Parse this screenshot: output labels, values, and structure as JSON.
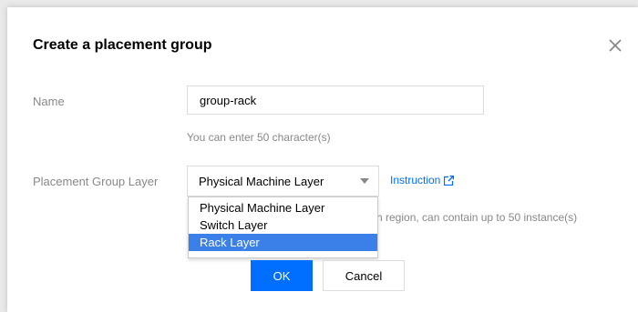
{
  "dialog": {
    "title": "Create a placement group",
    "close_icon": "close-icon"
  },
  "form": {
    "name_label": "Name",
    "name_value": "group-rack",
    "name_hint": "You can enter 50 character(s)",
    "layer_label": "Placement Group Layer",
    "layer_selected": "Physical Machine Layer",
    "layer_options": [
      {
        "label": "Physical Machine Layer",
        "selected": false
      },
      {
        "label": "Switch Layer",
        "selected": false
      },
      {
        "label": "Rack Layer",
        "selected": true
      }
    ],
    "instruction_link": "Instruction",
    "instruction_icon": "external-link-icon",
    "layer_desc_visible": "h region, can contain up to 50 instance(s)"
  },
  "buttons": {
    "ok": "OK",
    "cancel": "Cancel"
  },
  "colors": {
    "primary": "#006eff",
    "highlight": "#3b7fe9",
    "muted_text": "#888888"
  }
}
